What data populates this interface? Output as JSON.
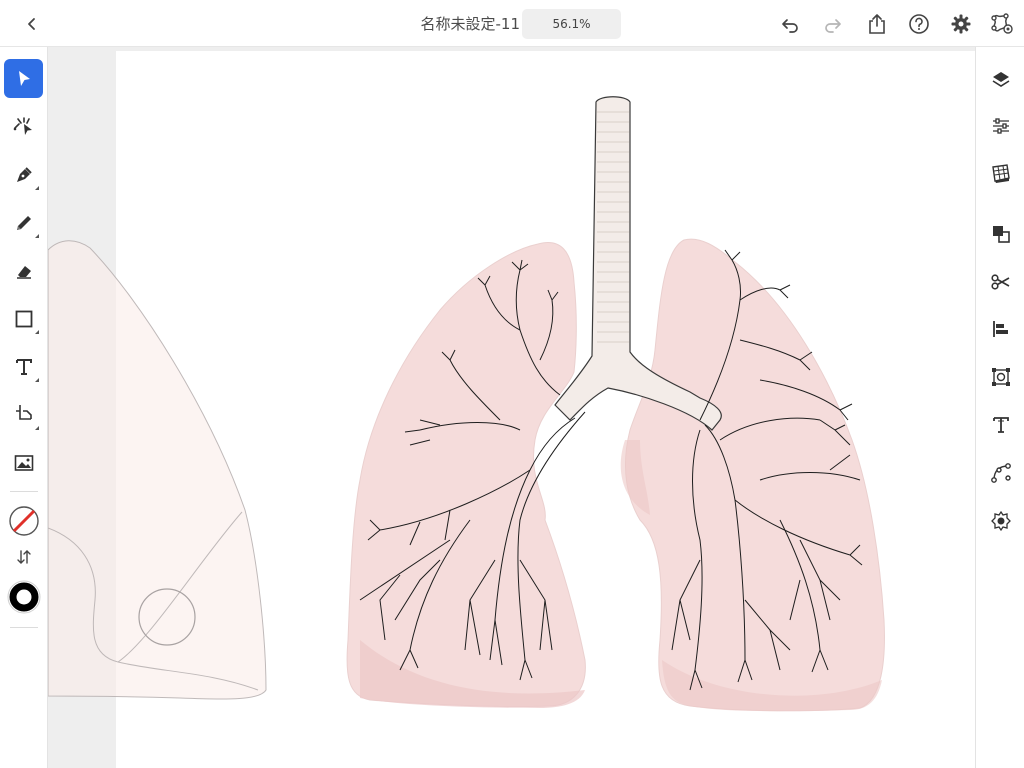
{
  "header": {
    "doc_title": "名称未設定-11",
    "zoom": "56.1%",
    "back_icon": "chevron-left-icon",
    "undo_icon": "undo-icon",
    "redo_icon": "redo-icon",
    "share_icon": "share-icon",
    "help_icon": "help-icon",
    "settings_icon": "gear-icon",
    "livestream_icon": "livestream-icon"
  },
  "left_toolbar": {
    "tools": [
      {
        "name": "selection-tool",
        "icon": "arrow-cursor-icon",
        "active": true
      },
      {
        "name": "direct-selection-tool",
        "icon": "direct-select-icon",
        "active": false
      },
      {
        "name": "pen-tool",
        "icon": "pen-nib-icon",
        "active": false
      },
      {
        "name": "pencil-tool",
        "icon": "pencil-icon",
        "active": false
      },
      {
        "name": "eraser-tool",
        "icon": "eraser-icon",
        "active": false
      },
      {
        "name": "shape-tool",
        "icon": "rectangle-icon",
        "active": false
      },
      {
        "name": "type-tool",
        "icon": "type-t-icon",
        "active": false
      },
      {
        "name": "transform-tool",
        "icon": "transform-icon",
        "active": false
      },
      {
        "name": "place-image-tool",
        "icon": "image-icon",
        "active": false
      }
    ],
    "fill_state": "none",
    "stroke_color": "#000000",
    "swap_icon": "swap-arrows-icon"
  },
  "right_panel": {
    "items": [
      {
        "name": "layers",
        "icon": "layers-icon"
      },
      {
        "name": "properties",
        "icon": "sliders-icon"
      },
      {
        "name": "libraries",
        "icon": "swatches-grid-icon"
      },
      {
        "name": "arrange",
        "icon": "arrange-icon"
      },
      {
        "name": "pathfinder",
        "icon": "scissors-icon"
      },
      {
        "name": "align",
        "icon": "align-left-icon"
      },
      {
        "name": "transform",
        "icon": "transform-box-icon"
      },
      {
        "name": "type-properties",
        "icon": "type-icon"
      },
      {
        "name": "path",
        "icon": "path-curve-icon"
      },
      {
        "name": "symbols",
        "icon": "symbol-icon"
      }
    ]
  },
  "colors": {
    "accent": "#2f6ee5",
    "lung_fill": "#f6dede",
    "lung_shadow": "#ebc9c9",
    "trachea_fill": "#f2ece8",
    "canvas_bg": "#eeeeee"
  }
}
